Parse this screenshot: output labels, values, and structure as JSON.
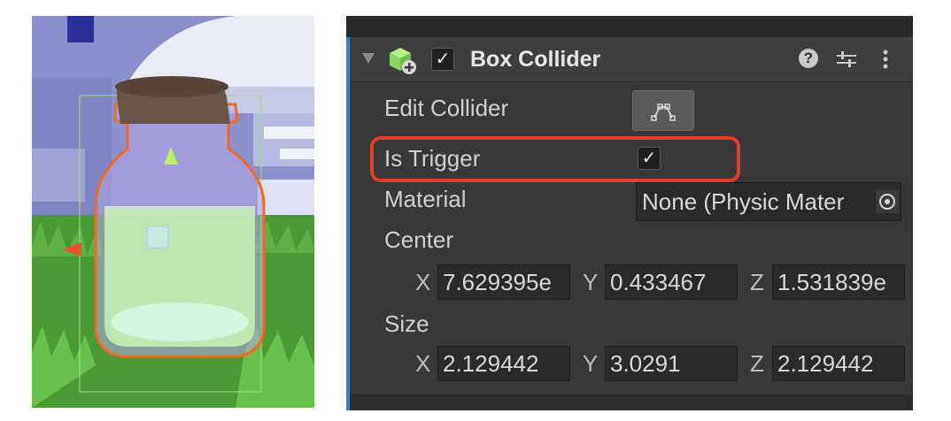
{
  "scene": {
    "description_icons": [
      "bottle-object",
      "move-gizmo-y-arrow",
      "move-gizmo-x-arrow",
      "box-collider-wireframe"
    ]
  },
  "inspector": {
    "component": {
      "title": "Box Collider",
      "enabled": true,
      "icons": [
        "fold-arrow-icon",
        "box-collider-icon",
        "help-icon",
        "preset-icon",
        "kebab-menu-icon"
      ]
    },
    "fields": {
      "edit_collider_label": "Edit Collider",
      "is_trigger_label": "Is Trigger",
      "is_trigger": true,
      "material_label": "Material",
      "material_value": "None (Physic Mater",
      "center_label": "Center",
      "size_label": "Size"
    },
    "center": {
      "x_label": "X",
      "x": "7.629395e",
      "y_label": "Y",
      "y": "0.433467",
      "z_label": "Z",
      "z": "1.531839e"
    },
    "size": {
      "x_label": "X",
      "x": "2.129442",
      "y_label": "Y",
      "y": "3.0291",
      "z_label": "Z",
      "z": "2.129442"
    },
    "check_glyph": "✓"
  },
  "colors": {
    "highlight": "#e0402a",
    "inspector_bg": "#383838",
    "accent_edge": "#3e7bbf",
    "selection_outline": "#f06a22"
  }
}
